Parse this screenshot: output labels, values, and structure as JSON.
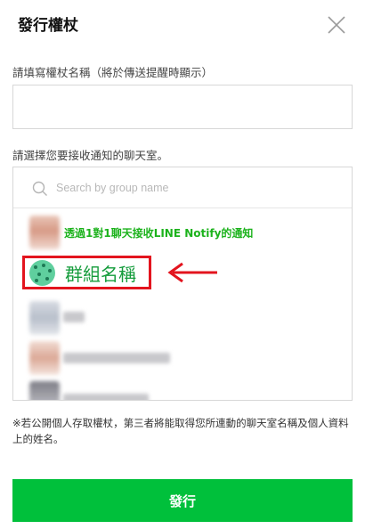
{
  "dialog": {
    "title": "發行權杖",
    "close_icon": "close-icon"
  },
  "token_name": {
    "label": "請填寫權杖名稱（將於傳送提醒時顯示）",
    "value": "",
    "placeholder": ""
  },
  "chat_room": {
    "label": "請選擇您要接收通知的聊天室。",
    "search_placeholder": "Search by group name",
    "items": [
      {
        "label": "透過1對1聊天接收LINE Notify的通知",
        "color": "#1bb21b"
      },
      {
        "label": "群組名稱",
        "color": "#159c3c",
        "highlight_color": "#e3141e"
      }
    ]
  },
  "annotation": {
    "arrow_color": "#e3141e",
    "arrow_icon": "left-arrow-icon"
  },
  "note": "※若公開個人存取權杖，第三者將能取得您所連動的聊天室名稱及個人資料上的姓名。",
  "submit_label": "發行",
  "colors": {
    "accent": "#00c03b"
  }
}
